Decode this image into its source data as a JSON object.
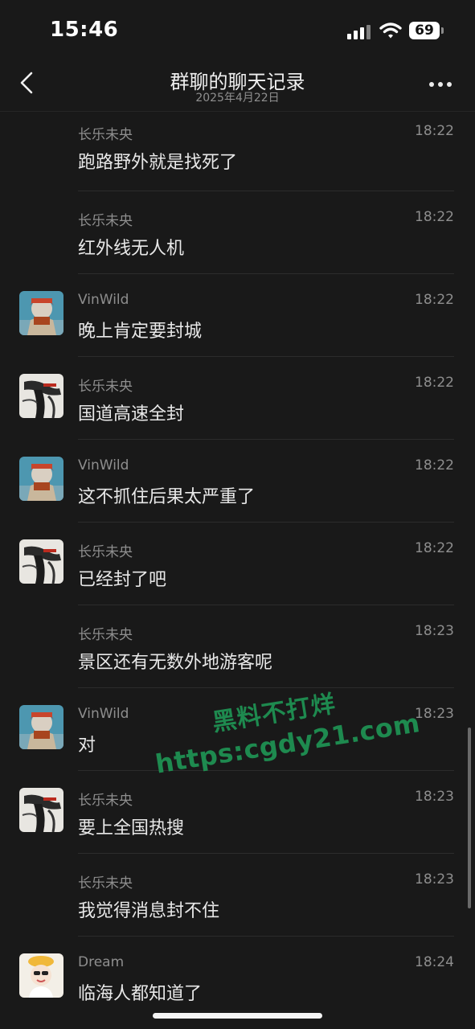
{
  "status_bar": {
    "time": "15:46",
    "battery": "69",
    "signal_icon": "signal-bars-icon",
    "wifi_icon": "wifi-icon"
  },
  "nav": {
    "back_icon": "chevron-left-icon",
    "title": "群聊的聊天记录",
    "subtitle": "2025年4月22日",
    "more_icon": "more-dots-icon"
  },
  "messages": [
    {
      "name": "长乐未央",
      "time": "18:22",
      "text": "跑路野外就是找死了",
      "avatar": "none"
    },
    {
      "name": "长乐未央",
      "time": "18:22",
      "text": "红外线无人机",
      "avatar": "none"
    },
    {
      "name": "VinWild",
      "time": "18:22",
      "text": "晚上肯定要封城",
      "avatar": "vinwild-avatar"
    },
    {
      "name": "长乐未央",
      "time": "18:22",
      "text": "国道高速全封",
      "avatar": "changle-avatar"
    },
    {
      "name": "VinWild",
      "time": "18:22",
      "text": "这不抓住后果太严重了",
      "avatar": "vinwild-avatar"
    },
    {
      "name": "长乐未央",
      "time": "18:22",
      "text": "已经封了吧",
      "avatar": "changle-avatar"
    },
    {
      "name": "长乐未央",
      "time": "18:23",
      "text": "景区还有无数外地游客呢",
      "avatar": "none"
    },
    {
      "name": "VinWild",
      "time": "18:23",
      "text": "对",
      "avatar": "vinwild-avatar"
    },
    {
      "name": "长乐未央",
      "time": "18:23",
      "text": "要上全国热搜",
      "avatar": "changle-avatar"
    },
    {
      "name": "长乐未央",
      "time": "18:23",
      "text": "我觉得消息封不住",
      "avatar": "none"
    },
    {
      "name": "Dream",
      "time": "18:24",
      "text": "临海人都知道了",
      "avatar": "dream-avatar"
    }
  ],
  "watermark": {
    "line1": "黑料不打烊",
    "line2": "https:cgdy21.com"
  }
}
